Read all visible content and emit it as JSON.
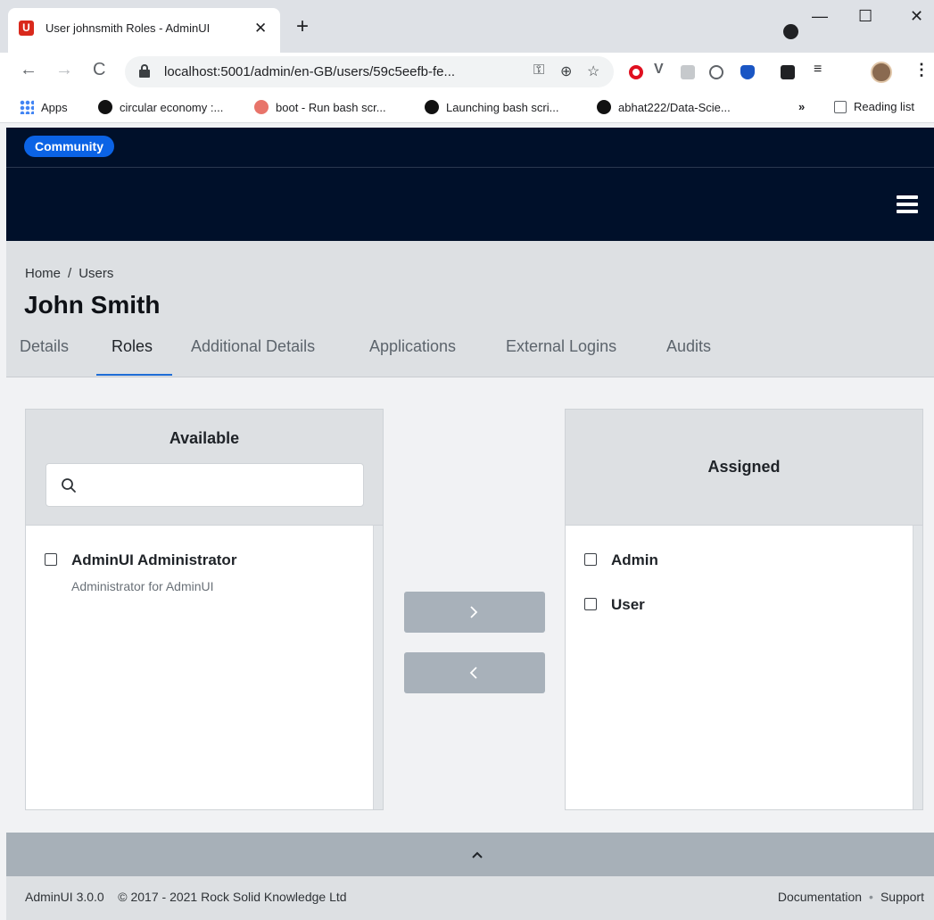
{
  "browser": {
    "tab_title": "User johnsmith Roles - AdminUI",
    "tab_close": "✕",
    "new_tab": "+",
    "url": "localhost:5001/admin/en-GB/users/59c5eefb-fe...",
    "bookmarks": [
      {
        "label": "Apps",
        "icon": "apps-grid-icon"
      },
      {
        "label": "circular economy :...",
        "icon": "notion-icon"
      },
      {
        "label": "boot - Run bash scr...",
        "icon": "stackoverflow-icon"
      },
      {
        "label": "Launching bash scri...",
        "icon": "github-icon"
      },
      {
        "label": "abhat222/Data-Scie...",
        "icon": "github-icon"
      }
    ],
    "bookmarks_more": "»",
    "reading_list": "Reading list",
    "window_controls": {
      "minimize": "—",
      "maximize": "☐",
      "close": "✕"
    }
  },
  "header": {
    "badge": "Community"
  },
  "breadcrumb": {
    "home": "Home",
    "separator": "/",
    "users": "Users"
  },
  "page_title": "John Smith",
  "tabs": [
    "Details",
    "Roles",
    "Additional Details",
    "Applications",
    "External Logins",
    "Audits"
  ],
  "active_tab": "Roles",
  "available": {
    "title": "Available",
    "search_placeholder": "",
    "items": [
      {
        "label": "AdminUI Administrator",
        "description": "Administrator for AdminUI",
        "checked": false
      }
    ]
  },
  "assigned": {
    "title": "Assigned",
    "items": [
      {
        "label": "Admin",
        "checked": false
      },
      {
        "label": "User",
        "checked": false
      }
    ]
  },
  "footer": {
    "version": "AdminUI 3.0.0",
    "copyright": "© 2017 - 2021 Rock Solid Knowledge Ltd",
    "documentation": "Documentation",
    "separator": "•",
    "support": "Support"
  },
  "colors": {
    "navbar": "#00102a",
    "badge": "#0b63e5",
    "active_tab_underline": "#1f6dd6",
    "move_button": "#a8b1ba"
  }
}
